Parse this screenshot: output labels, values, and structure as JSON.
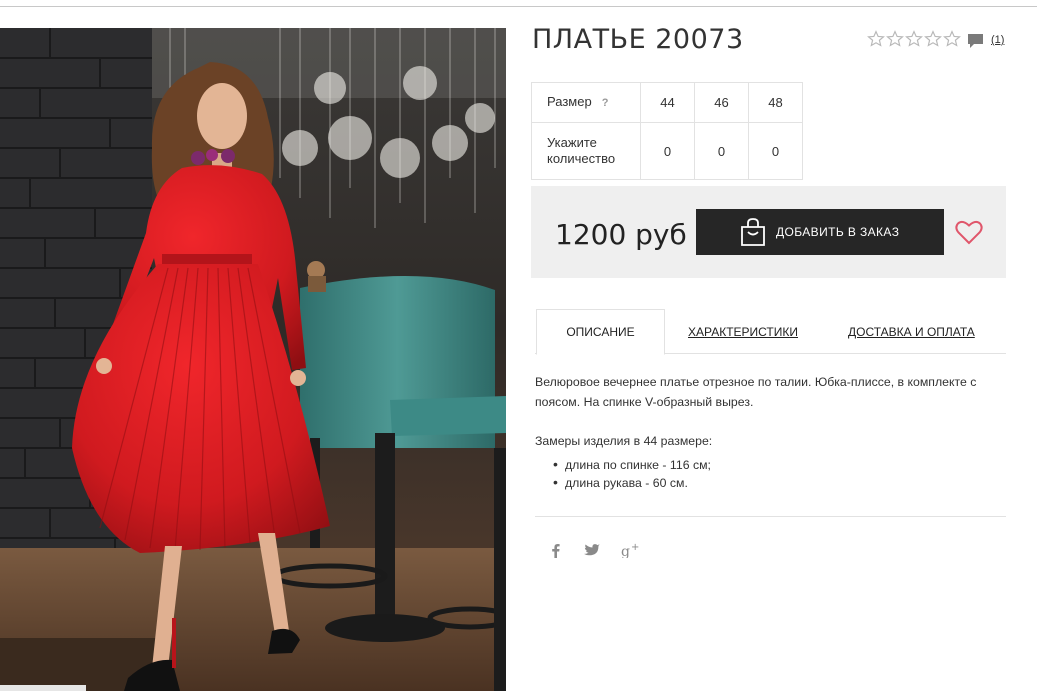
{
  "product": {
    "title": "ПЛАТЬЕ 20073",
    "rating": 0,
    "rating_max": 5,
    "review_count": "(1)",
    "price": "1200 руб",
    "add_button_label": "ДОБАВИТЬ В ЗАКАЗ"
  },
  "sizes": {
    "size_label": "Размер",
    "help_mark": "?",
    "qty_label_line1": "Укажите",
    "qty_label_line2": "количество",
    "values": [
      "44",
      "46",
      "48"
    ],
    "quantities": [
      "0",
      "0",
      "0"
    ]
  },
  "tabs": [
    {
      "label": "ОПИСАНИЕ",
      "active": true
    },
    {
      "label": "ХАРАКТЕРИСТИКИ",
      "active": false
    },
    {
      "label": "ДОСТАВКА И ОПЛАТА",
      "active": false
    }
  ],
  "description": {
    "text": "Велюровое вечернее платье отрезное по талии. Юбка-плиссе, в комплекте с поясом. На спинке V-образный вырез.",
    "measures_title": "Замеры изделия в 44 размере:",
    "measures": [
      "длина по спинке - 116 см;",
      "длина рукава - 60 см."
    ]
  },
  "social": [
    "facebook-icon",
    "twitter-icon",
    "google-plus-icon"
  ],
  "colors": {
    "button_bg": "#262626",
    "heart": "#e0566b",
    "price_band": "#efefef",
    "dress": "#d8191e"
  },
  "icons": {
    "star": "star-outline-icon",
    "comment": "comment-icon",
    "bag": "shopping-bag-icon",
    "heart": "heart-outline-icon"
  }
}
